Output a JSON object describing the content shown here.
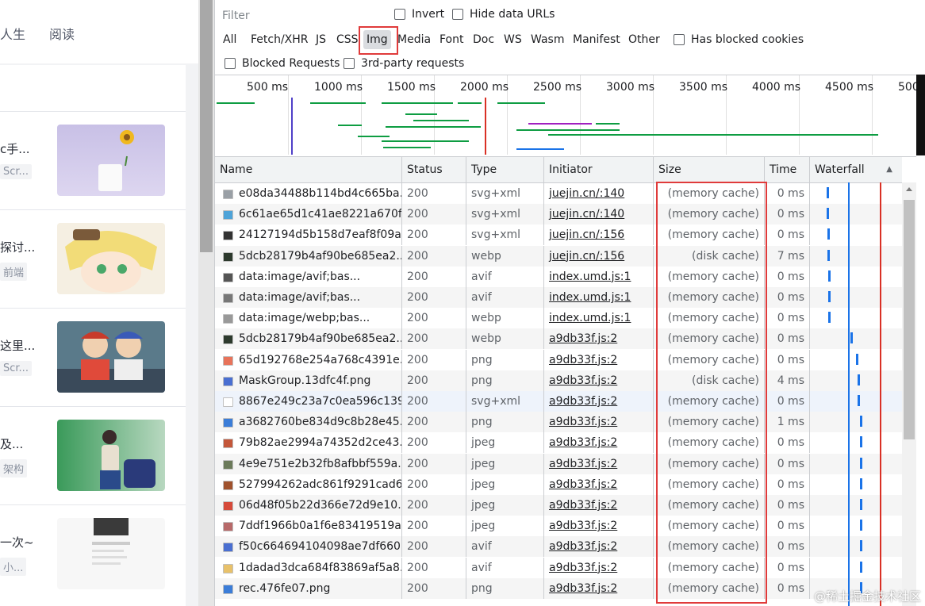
{
  "left": {
    "nav": [
      "人生",
      "阅读"
    ],
    "articles": [
      {
        "title": "c手...",
        "tag": "Scr..."
      },
      {
        "title": "探讨...",
        "tag": "前端"
      },
      {
        "title": "这里...",
        "tag": "Scr..."
      },
      {
        "title": "及...",
        "tag": "架构"
      },
      {
        "title": "一次~",
        "tag": "小..."
      }
    ]
  },
  "toolbar": {
    "filter_placeholder": "Filter",
    "invert": "Invert",
    "hide_data_urls": "Hide data URLs",
    "types": [
      "All",
      "Fetch/XHR",
      "JS",
      "CSS",
      "Img",
      "Media",
      "Font",
      "Doc",
      "WS",
      "Wasm",
      "Manifest",
      "Other"
    ],
    "selected_type": "Img",
    "has_blocked_cookies": "Has blocked cookies",
    "blocked_requests": "Blocked Requests",
    "third_party": "3rd-party requests"
  },
  "overview": {
    "ticks": [
      "500 ms",
      "1000 ms",
      "1500 ms",
      "2000 ms",
      "2500 ms",
      "3000 ms",
      "3500 ms",
      "4000 ms",
      "4500 ms",
      "500"
    ]
  },
  "columns": {
    "name": "Name",
    "status": "Status",
    "type": "Type",
    "initiator": "Initiator",
    "size": "Size",
    "time": "Time",
    "waterfall": "Waterfall"
  },
  "rows": [
    {
      "name": "e08da34488b114bd4c665ba...",
      "status": "200",
      "type": "svg+xml",
      "initiator": "juejin.cn/:140",
      "size": "(memory cache)",
      "time": "0 ms",
      "icon_color": "#9aa0a6",
      "wf": 0.18
    },
    {
      "name": "6c61ae65d1c41ae8221a670f...",
      "status": "200",
      "type": "svg+xml",
      "initiator": "juejin.cn/:140",
      "size": "(memory cache)",
      "time": "0 ms",
      "icon_color": "#4ea3d8",
      "wf": 0.18
    },
    {
      "name": "24127194d5b158d7eaf8f09a...",
      "status": "200",
      "type": "svg+xml",
      "initiator": "juejin.cn/:156",
      "size": "(memory cache)",
      "time": "0 ms",
      "icon_color": "#333333",
      "wf": 0.19
    },
    {
      "name": "5dcb28179b4af90be685ea2...",
      "status": "200",
      "type": "webp",
      "initiator": "juejin.cn/:156",
      "size": "(disk cache)",
      "time": "7 ms",
      "icon_color": "#2d3a2d",
      "wf": 0.19
    },
    {
      "name": "data:image/avif;bas...",
      "status": "200",
      "type": "avif",
      "initiator": "index.umd.js:1",
      "size": "(memory cache)",
      "time": "0 ms",
      "icon_color": "#555555",
      "wf": 0.2
    },
    {
      "name": "data:image/avif;bas...",
      "status": "200",
      "type": "avif",
      "initiator": "index.umd.js:1",
      "size": "(memory cache)",
      "time": "0 ms",
      "icon_color": "#777777",
      "wf": 0.2
    },
    {
      "name": "data:image/webp;bas...",
      "status": "200",
      "type": "webp",
      "initiator": "index.umd.js:1",
      "size": "(memory cache)",
      "time": "0 ms",
      "icon_color": "#999999",
      "wf": 0.2
    },
    {
      "name": "5dcb28179b4af90be685ea2...",
      "status": "200",
      "type": "webp",
      "initiator": "a9db33f.js:2",
      "size": "(memory cache)",
      "time": "0 ms",
      "icon_color": "#2d3a2d",
      "wf": 0.44
    },
    {
      "name": "65d192768e254a768c4391e...",
      "status": "200",
      "type": "png",
      "initiator": "a9db33f.js:2",
      "size": "(memory cache)",
      "time": "0 ms",
      "icon_color": "#e8735a",
      "wf": 0.5
    },
    {
      "name": "MaskGroup.13dfc4f.png",
      "status": "200",
      "type": "png",
      "initiator": "a9db33f.js:2",
      "size": "(disk cache)",
      "time": "4 ms",
      "icon_color": "#4a6fd1",
      "wf": 0.52
    },
    {
      "name": "8867e249c23a7c0ea596c139...",
      "status": "200",
      "type": "svg+xml",
      "initiator": "a9db33f.js:2",
      "size": "(memory cache)",
      "time": "0 ms",
      "icon_color": "#ffffff",
      "wf": 0.52
    },
    {
      "name": "a3682760be834d9c8b28e45...",
      "status": "200",
      "type": "png",
      "initiator": "a9db33f.js:2",
      "size": "(memory cache)",
      "time": "1 ms",
      "icon_color": "#3b7dd8",
      "wf": 0.54
    },
    {
      "name": "79b82ae2994a74352d2ce43...",
      "status": "200",
      "type": "jpeg",
      "initiator": "a9db33f.js:2",
      "size": "(memory cache)",
      "time": "0 ms",
      "icon_color": "#c4573a",
      "wf": 0.54
    },
    {
      "name": "4e9e751e2b32fb8afbbf559a...",
      "status": "200",
      "type": "jpeg",
      "initiator": "a9db33f.js:2",
      "size": "(memory cache)",
      "time": "0 ms",
      "icon_color": "#6b7a5a",
      "wf": 0.54
    },
    {
      "name": "527994262adc861f9291cad6...",
      "status": "200",
      "type": "jpeg",
      "initiator": "a9db33f.js:2",
      "size": "(memory cache)",
      "time": "0 ms",
      "icon_color": "#a0522d",
      "wf": 0.54
    },
    {
      "name": "06d48f05b22d366e72d9e10...",
      "status": "200",
      "type": "jpeg",
      "initiator": "a9db33f.js:2",
      "size": "(memory cache)",
      "time": "0 ms",
      "icon_color": "#d64a3a",
      "wf": 0.54
    },
    {
      "name": "7ddf1966b0a1f6e83419519a...",
      "status": "200",
      "type": "jpeg",
      "initiator": "a9db33f.js:2",
      "size": "(memory cache)",
      "time": "0 ms",
      "icon_color": "#b86a6a",
      "wf": 0.54
    },
    {
      "name": "f50c664694104098ae7df660...",
      "status": "200",
      "type": "avif",
      "initiator": "a9db33f.js:2",
      "size": "(memory cache)",
      "time": "0 ms",
      "icon_color": "#4a6fd1",
      "wf": 0.54
    },
    {
      "name": "1dadad3dca684f83869af5a8...",
      "status": "200",
      "type": "avif",
      "initiator": "a9db33f.js:2",
      "size": "(memory cache)",
      "time": "0 ms",
      "icon_color": "#e8c16a",
      "wf": 0.54
    },
    {
      "name": "rec.476fe07.png",
      "status": "200",
      "type": "png",
      "initiator": "a9db33f.js:2",
      "size": "(memory cache)",
      "time": "0 ms",
      "icon_color": "#3b7dd8",
      "wf": 0.54
    }
  ],
  "watermark": "@稀土掘金技术社区"
}
